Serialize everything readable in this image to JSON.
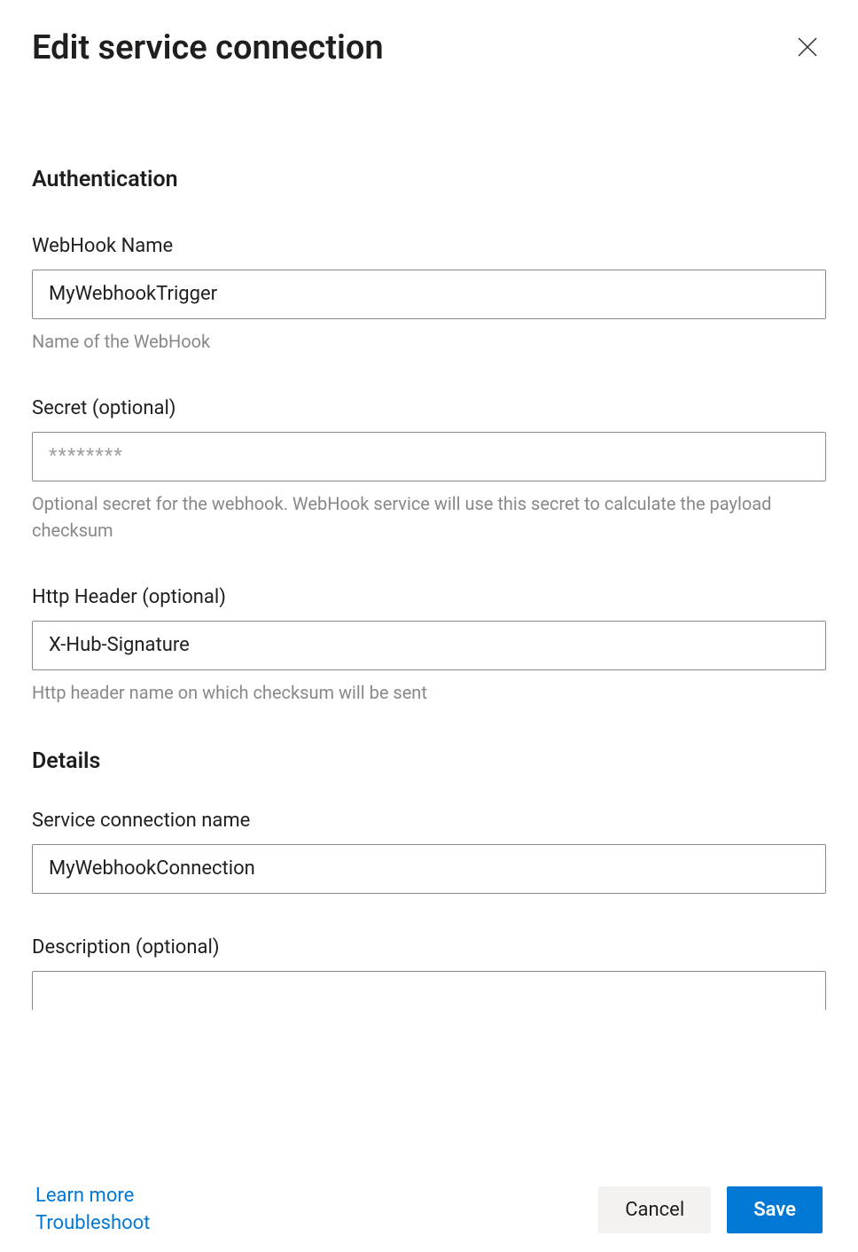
{
  "header": {
    "title": "Edit service connection"
  },
  "sections": {
    "authentication": {
      "heading": "Authentication",
      "webhook_name": {
        "label": "WebHook Name",
        "value": "MyWebhookTrigger",
        "help": "Name of the WebHook"
      },
      "secret": {
        "label": "Secret (optional)",
        "placeholder": "********",
        "value": "",
        "help": "Optional secret for the webhook. WebHook service will use this secret to calculate the payload checksum"
      },
      "http_header": {
        "label": "Http Header (optional)",
        "value": "X-Hub-Signature",
        "help": "Http header name on which checksum will be sent"
      }
    },
    "details": {
      "heading": "Details",
      "service_connection_name": {
        "label": "Service connection name",
        "value": "MyWebhookConnection"
      },
      "description": {
        "label": "Description (optional)",
        "value": ""
      }
    }
  },
  "footer": {
    "learn_more": "Learn more",
    "troubleshoot": "Troubleshoot",
    "cancel": "Cancel",
    "save": "Save"
  }
}
